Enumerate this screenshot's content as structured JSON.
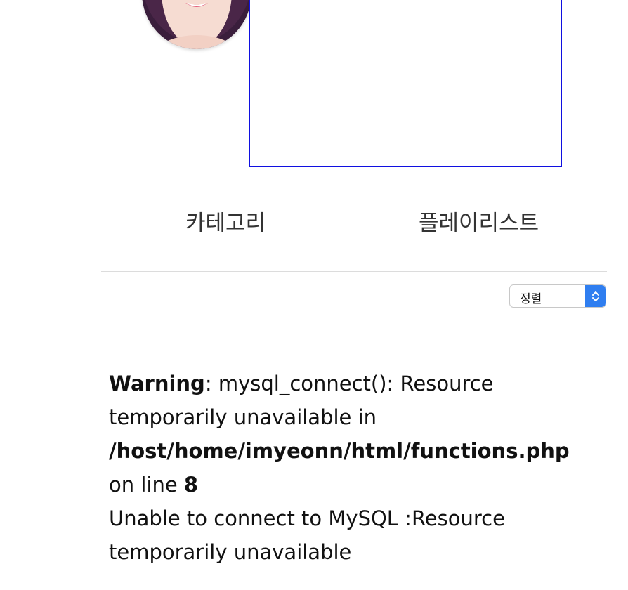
{
  "profile": {
    "avatar_icon": "profile-photo"
  },
  "tabs": {
    "category": "카테고리",
    "playlist": "플레이리스트"
  },
  "sort": {
    "selected": "정렬"
  },
  "error": {
    "warning_label": "Warning",
    "warning_sep": ": ",
    "message_part1": "mysql_connect(): Resource temporarily unavailable in ",
    "file_path": "/host/home/imyeonn/html/functions.php",
    "on_line_text": " on line ",
    "line_number": "8",
    "connect_error": "Unable to connect to MySQL :Resource temporarily unavailable"
  },
  "colors": {
    "box_border": "#1010e0",
    "select_accent": "#2f7ef0",
    "divider": "#dcdcdc"
  }
}
